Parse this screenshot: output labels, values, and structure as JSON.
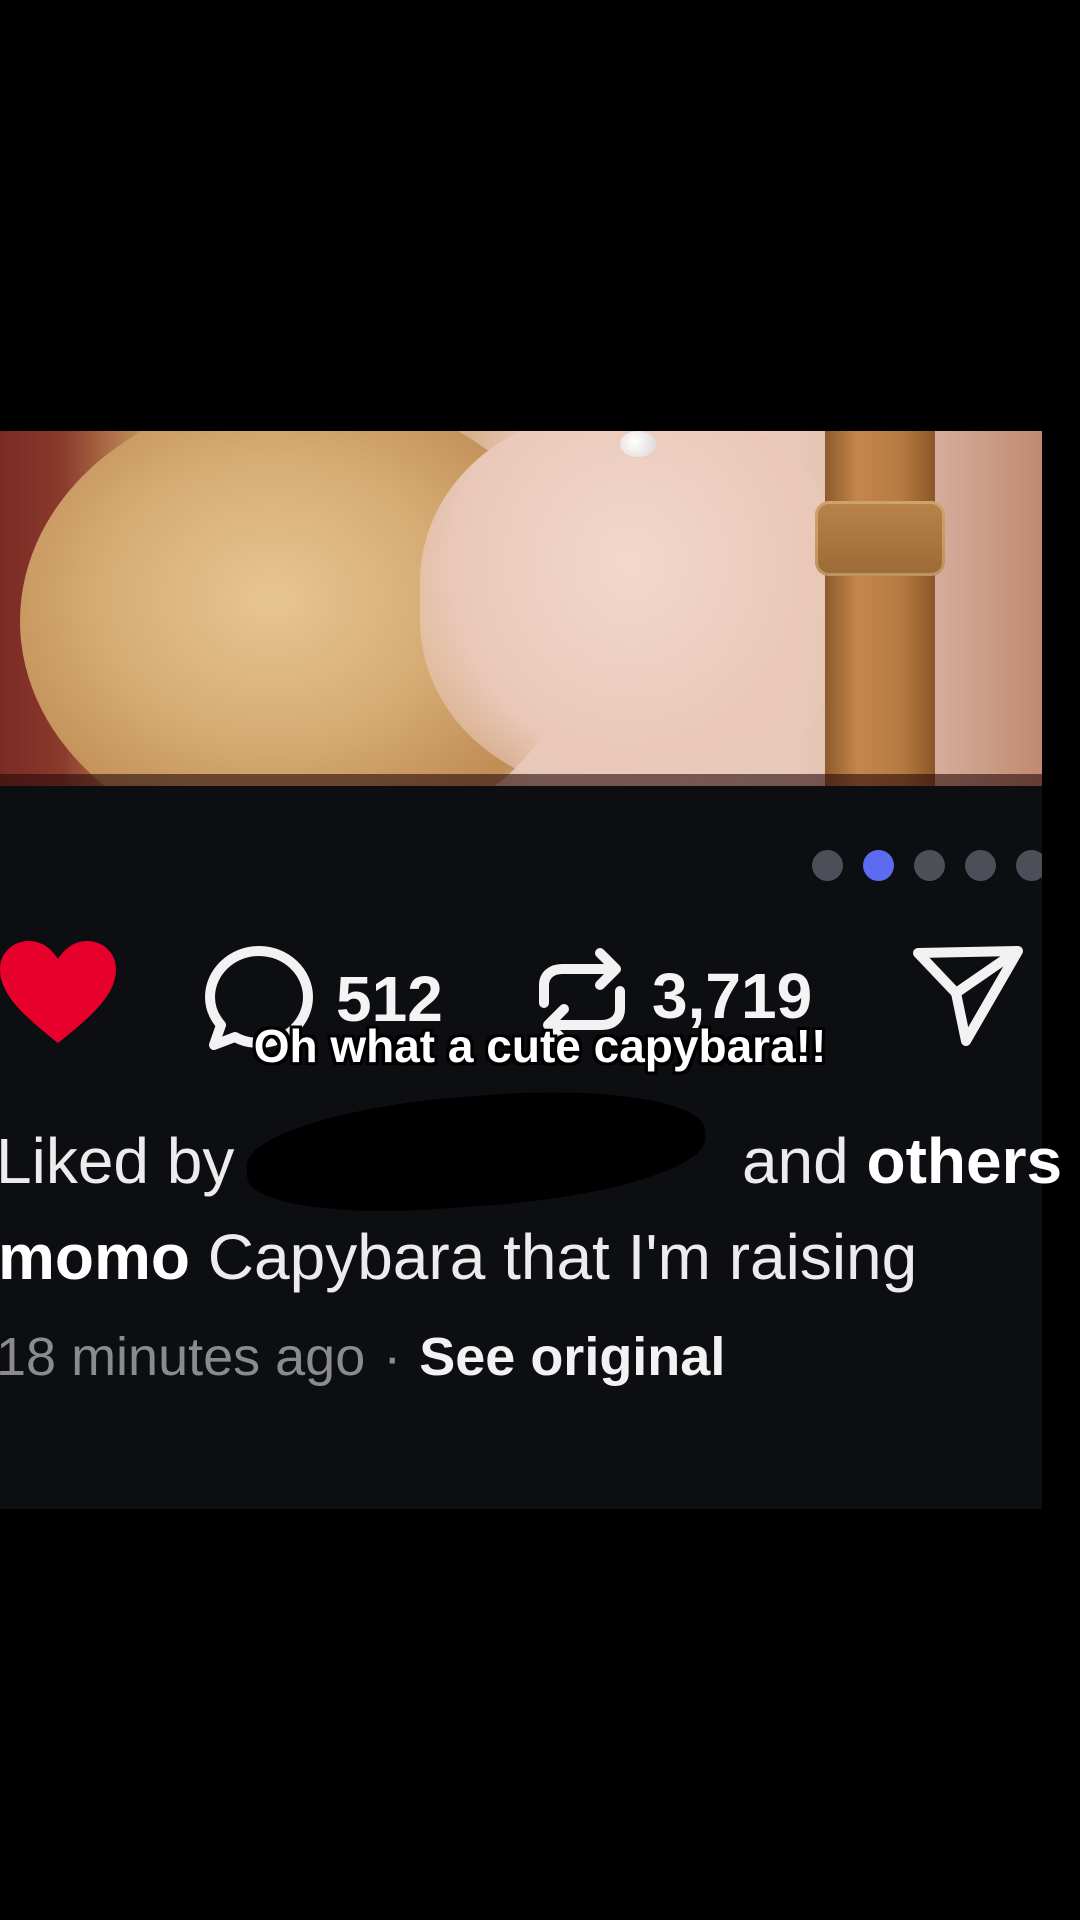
{
  "post": {
    "carousel": {
      "total_slides": 5,
      "active_index": 1
    },
    "actions": {
      "like": {
        "icon": "heart-filled-icon",
        "color": "#e8002d",
        "liked": true
      },
      "comment": {
        "icon": "comment-bubble-icon",
        "count": "512"
      },
      "repost": {
        "icon": "repost-icon",
        "count": "3,719"
      },
      "share": {
        "icon": "send-icon"
      }
    },
    "liked_by": {
      "prefix": "Liked by",
      "suffix": "and",
      "others": "others"
    },
    "caption": {
      "username": "momo",
      "text": "Capybara that I'm raising"
    },
    "meta": {
      "time": "18 minutes ago",
      "separator": "·",
      "see_original": "See original"
    }
  },
  "video_caption": "Oh what a cute capybara!!",
  "colors": {
    "background": "#000000",
    "panel": "#0d0e12",
    "accent_dot": "#5b6cf0",
    "like_red": "#e8002d"
  }
}
